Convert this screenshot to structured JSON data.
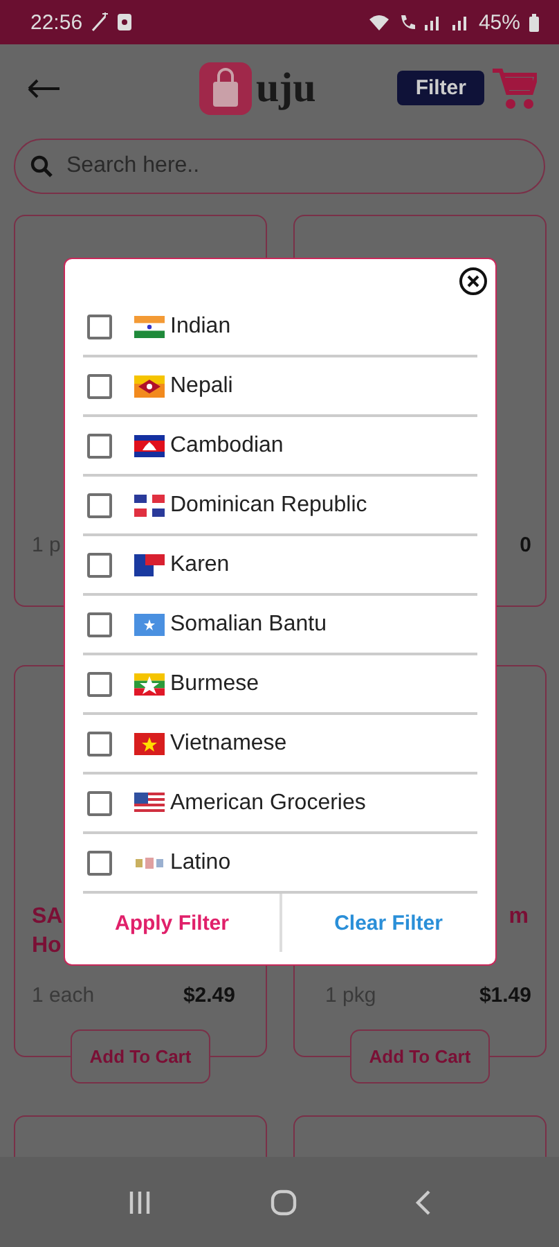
{
  "status_bar": {
    "time": "22:56",
    "battery": "45%"
  },
  "header": {
    "logo_text": "uju",
    "filter_button": "Filter"
  },
  "search": {
    "placeholder": "Search here.."
  },
  "products": [
    {
      "kind": "product",
      "quantity": "1 p"
    },
    {
      "kind": "product",
      "price": "0"
    },
    {
      "kind": "product",
      "title_lines": [
        "SA",
        "Ho"
      ],
      "quantity": "1 each",
      "price": "$2.49",
      "button": "Add To Cart"
    },
    {
      "kind": "product",
      "title_lines": [
        "m"
      ],
      "quantity": "1 pkg",
      "price": "$1.49",
      "button": "Add To Cart"
    },
    {
      "kind": "product"
    },
    {
      "kind": "product"
    }
  ],
  "filter_dialog": {
    "options": [
      {
        "label": "Indian",
        "checked": false
      },
      {
        "label": "Nepali",
        "checked": false
      },
      {
        "label": "Cambodian",
        "checked": false
      },
      {
        "label": "Dominican Republic",
        "checked": false
      },
      {
        "label": "Karen",
        "checked": false
      },
      {
        "label": "Somalian Bantu",
        "checked": false
      },
      {
        "label": "Burmese",
        "checked": false
      },
      {
        "label": "Vietnamese",
        "checked": false
      },
      {
        "label": "American Groceries",
        "checked": false
      },
      {
        "label": "Latino",
        "checked": false
      }
    ],
    "apply_button": "Apply Filter",
    "clear_button": "Clear Filter"
  }
}
